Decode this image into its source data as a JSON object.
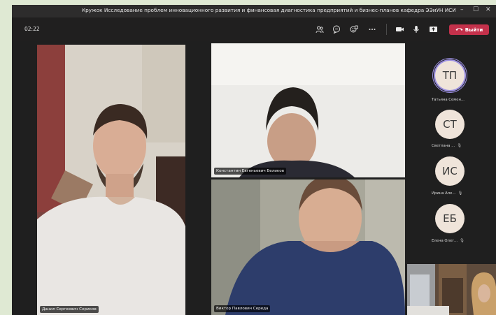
{
  "window": {
    "title": "Кружок Исследование проблем инновационного развития и финансовая диагностика предприятий и бизнес-планов кафедра ЭЭиУН ИСИ",
    "minimize": "–",
    "maximize": "☐",
    "close": "✕"
  },
  "toolbar": {
    "timer": "02:22",
    "leave_label": "Выйти",
    "icons": [
      "people-icon",
      "chat-icon",
      "reactions-icon",
      "more-icon",
      "camera-icon",
      "mic-icon",
      "share-icon",
      "phone-icon"
    ]
  },
  "participants": [
    {
      "name": "Данил Сергеевич Сериков"
    },
    {
      "name": "Константин Евгеньевич Беликов"
    },
    {
      "name": "Виктор Павлович Середа"
    }
  ],
  "roster": [
    {
      "initials": "ТП",
      "label": "Татьяна Семен...",
      "active": true,
      "muted": false
    },
    {
      "initials": "СТ",
      "label": "Светлана ...",
      "active": false,
      "muted": true
    },
    {
      "initials": "ИС",
      "label": "Ирина Але...",
      "active": false,
      "muted": true
    },
    {
      "initials": "ЕБ",
      "label": "Елена Олег...",
      "active": false,
      "muted": true
    }
  ],
  "colors": {
    "accent": "#c4314b",
    "ring": "#9b8fe0",
    "titlebar": "#2d2c2c",
    "stage": "#1f1f1f"
  }
}
